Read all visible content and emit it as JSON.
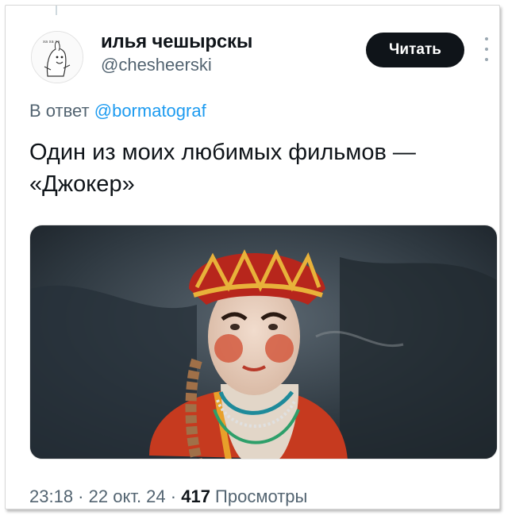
{
  "author": {
    "name": "илья чешырскы",
    "handle": "@chesheerski",
    "avatar_caption": "ха ха ха"
  },
  "follow_button": {
    "label": "Читать"
  },
  "reply": {
    "prefix": "В ответ ",
    "mention": "@bormatograf"
  },
  "tweet": {
    "text": "Один из моих любимых фильмов —\n«Джокер»"
  },
  "media": {
    "description_icon": "photo"
  },
  "meta": {
    "time": "23:18",
    "sep1": " · ",
    "date": "22 окт. 24",
    "sep2": " · ",
    "views_count": "417",
    "views_label": " Просмотры"
  },
  "colors": {
    "accent": "#1d9bf0",
    "text": "#0f1419",
    "muted": "#536471",
    "button": "#0f1419"
  }
}
